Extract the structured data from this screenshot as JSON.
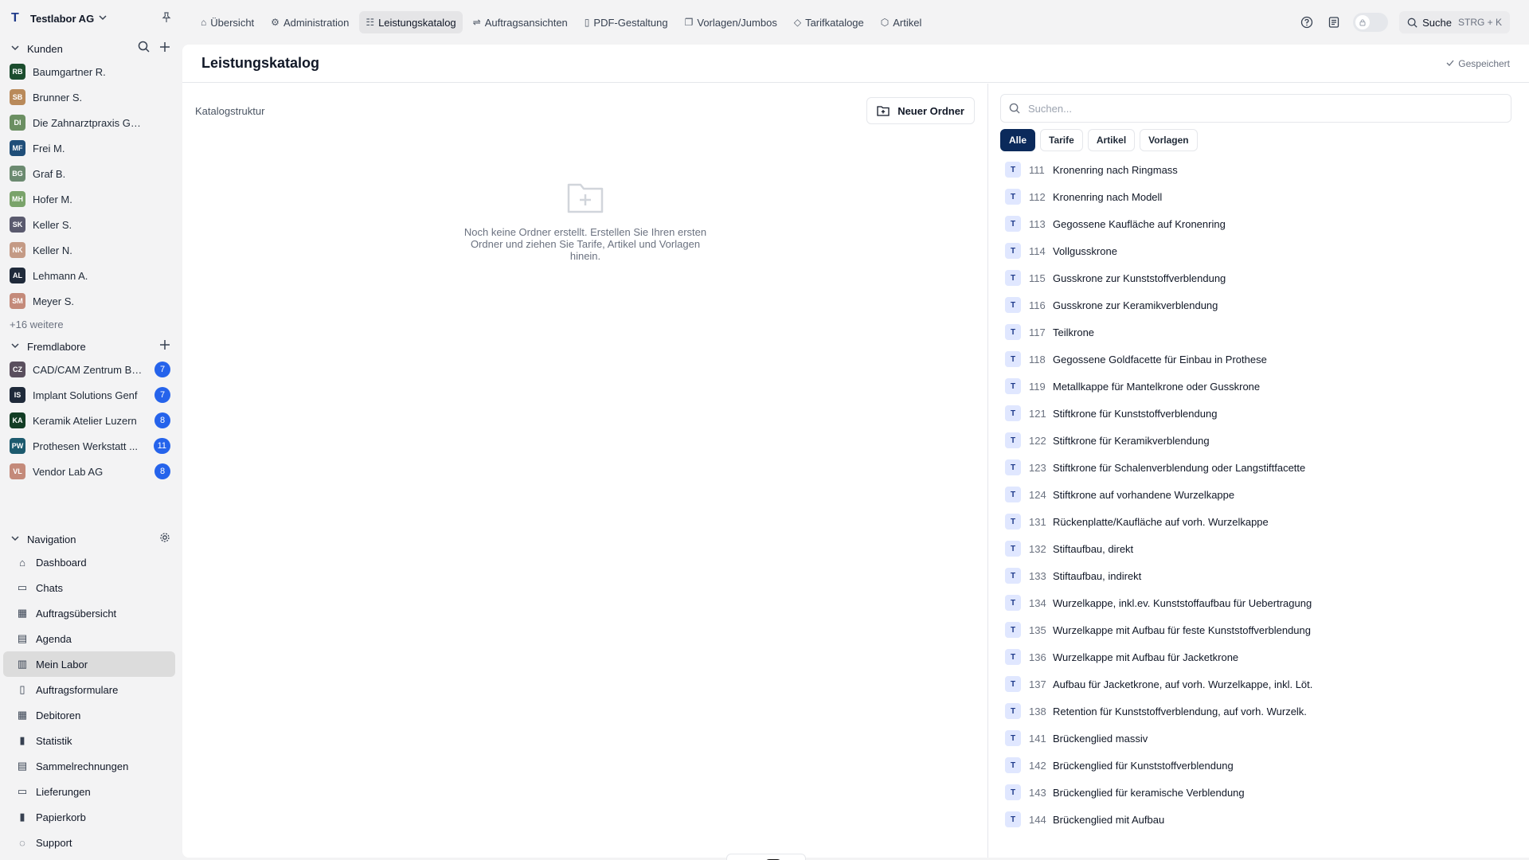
{
  "workspace": {
    "logo": "T",
    "name": "Testlabor AG"
  },
  "kunden": {
    "title": "Kunden",
    "items": [
      {
        "initials": "RB",
        "name": "Baumgartner R.",
        "color": "#1b4d2e"
      },
      {
        "initials": "SB",
        "name": "Brunner S.",
        "color": "#b98a5a"
      },
      {
        "initials": "DI",
        "name": "Die Zahnarztpraxis GmbH",
        "color": "#6b8f62"
      },
      {
        "initials": "MF",
        "name": "Frei M.",
        "color": "#1f4e79"
      },
      {
        "initials": "BG",
        "name": "Graf B.",
        "color": "#6b8a70"
      },
      {
        "initials": "MH",
        "name": "Hofer M.",
        "color": "#7aa36a"
      },
      {
        "initials": "SK",
        "name": "Keller S.",
        "color": "#5a5a6e"
      },
      {
        "initials": "NK",
        "name": "Keller N.",
        "color": "#c49a85"
      },
      {
        "initials": "AL",
        "name": "Lehmann A.",
        "color": "#1f2a3a"
      },
      {
        "initials": "SM",
        "name": "Meyer S.",
        "color": "#c48a7a"
      }
    ],
    "more": "+16 weitere"
  },
  "fremdlabore": {
    "title": "Fremdlabore",
    "items": [
      {
        "initials": "CZ",
        "name": "CAD/CAM Zentrum Ba...",
        "color": "#5a4f5e",
        "count": "7"
      },
      {
        "initials": "IS",
        "name": "Implant Solutions Genf",
        "color": "#1f2a3a",
        "count": "7"
      },
      {
        "initials": "KA",
        "name": "Keramik Atelier Luzern",
        "color": "#123d25",
        "count": "8"
      },
      {
        "initials": "PW",
        "name": "Prothesen Werkstatt ...",
        "color": "#1c5a6e",
        "count": "11"
      },
      {
        "initials": "VL",
        "name": "Vendor Lab AG",
        "color": "#c48a7a",
        "count": "8"
      }
    ]
  },
  "navigation": {
    "title": "Navigation",
    "items": [
      {
        "label": "Dashboard",
        "icon": "home-icon",
        "glyph": "⌂"
      },
      {
        "label": "Chats",
        "icon": "chat-icon",
        "glyph": "▭"
      },
      {
        "label": "Auftragsübersicht",
        "icon": "grid-icon",
        "glyph": "▦"
      },
      {
        "label": "Agenda",
        "icon": "agenda-icon",
        "glyph": "▤"
      },
      {
        "label": "Mein Labor",
        "icon": "lab-icon",
        "glyph": "▥"
      },
      {
        "label": "Auftragsformulare",
        "icon": "form-icon",
        "glyph": "▯"
      },
      {
        "label": "Debitoren",
        "icon": "table-icon",
        "glyph": "▦"
      },
      {
        "label": "Statistik",
        "icon": "bar-chart-icon",
        "glyph": "▮"
      },
      {
        "label": "Sammelrechnungen",
        "icon": "invoice-icon",
        "glyph": "▤"
      },
      {
        "label": "Lieferungen",
        "icon": "truck-icon",
        "glyph": "▭"
      },
      {
        "label": "Papierkorb",
        "icon": "trash-icon",
        "glyph": "▮"
      },
      {
        "label": "Support",
        "icon": "support-icon",
        "glyph": "◌"
      }
    ],
    "active": "Mein Labor"
  },
  "tabs": [
    {
      "label": "Übersicht",
      "icon": "home-icon",
      "glyph": "⌂"
    },
    {
      "label": "Administration",
      "icon": "gear-icon",
      "glyph": "⚙"
    },
    {
      "label": "Leistungskatalog",
      "icon": "catalog-icon",
      "glyph": "☷"
    },
    {
      "label": "Auftragsansichten",
      "icon": "sliders-icon",
      "glyph": "⇌"
    },
    {
      "label": "PDF-Gestaltung",
      "icon": "document-icon",
      "glyph": "▯"
    },
    {
      "label": "Vorlagen/Jumbos",
      "icon": "copy-icon",
      "glyph": "❐"
    },
    {
      "label": "Tarifkataloge",
      "icon": "tag-icon",
      "glyph": "◇"
    },
    {
      "label": "Artikel",
      "icon": "box-icon",
      "glyph": "⬡"
    }
  ],
  "active_tab": "Leistungskatalog",
  "topbar": {
    "search_label": "Suche",
    "search_shortcut": "STRG + K"
  },
  "page": {
    "title": "Leistungskatalog",
    "saved_label": "Gespeichert",
    "structure_title": "Katalogstruktur",
    "new_folder_label": "Neuer Ordner",
    "empty_text": "Noch keine Ordner erstellt. Erstellen Sie Ihren ersten Ordner und ziehen Sie Tarife, Artikel und Vorlagen hinein."
  },
  "catalog": {
    "search_placeholder": "Suchen...",
    "filters": [
      "Alle",
      "Tarife",
      "Artikel",
      "Vorlagen"
    ],
    "active_filter": "Alle",
    "items": [
      {
        "type": "T",
        "code": "111",
        "name": "Kronenring nach Ringmass"
      },
      {
        "type": "T",
        "code": "112",
        "name": "Kronenring nach Modell"
      },
      {
        "type": "T",
        "code": "113",
        "name": "Gegossene Kaufläche auf Kronenring"
      },
      {
        "type": "T",
        "code": "114",
        "name": "Vollgusskrone"
      },
      {
        "type": "T",
        "code": "115",
        "name": "Gusskrone zur Kunststoffverblendung"
      },
      {
        "type": "T",
        "code": "116",
        "name": "Gusskrone zur Keramikverblendung"
      },
      {
        "type": "T",
        "code": "117",
        "name": "Teilkrone"
      },
      {
        "type": "T",
        "code": "118",
        "name": "Gegossene Goldfacette für Einbau in Prothese"
      },
      {
        "type": "T",
        "code": "119",
        "name": "Metallkappe für Mantelkrone oder Gusskrone"
      },
      {
        "type": "T",
        "code": "121",
        "name": "Stiftkrone für Kunststoffverblendung"
      },
      {
        "type": "T",
        "code": "122",
        "name": "Stiftkrone für Keramikverblendung"
      },
      {
        "type": "T",
        "code": "123",
        "name": "Stiftkrone für Schalenverblendung oder Langstiftfacette"
      },
      {
        "type": "T",
        "code": "124",
        "name": "Stiftkrone auf vorhandene Wurzelkappe"
      },
      {
        "type": "T",
        "code": "131",
        "name": "Rückenplatte/Kaufläche auf vorh. Wurzelkappe"
      },
      {
        "type": "T",
        "code": "132",
        "name": "Stiftaufbau, direkt"
      },
      {
        "type": "T",
        "code": "133",
        "name": "Stiftaufbau, indirekt"
      },
      {
        "type": "T",
        "code": "134",
        "name": "Wurzelkappe, inkl.ev. Kunststoffaufbau für Uebertragung"
      },
      {
        "type": "T",
        "code": "135",
        "name": "Wurzelkappe mit Aufbau für feste Kunststoffverblendung"
      },
      {
        "type": "T",
        "code": "136",
        "name": "Wurzelkappe mit Aufbau für Jacketkrone"
      },
      {
        "type": "T",
        "code": "137",
        "name": "Aufbau für Jacketkrone, auf vorh. Wurzelkappe, inkl. Löt."
      },
      {
        "type": "T",
        "code": "138",
        "name": "Retention für Kunststoffverblendung, auf vorh. Wurzelk."
      },
      {
        "type": "T",
        "code": "141",
        "name": "Brückenglied massiv"
      },
      {
        "type": "T",
        "code": "142",
        "name": "Brückenglied für Kunststoffverblendung"
      },
      {
        "type": "T",
        "code": "143",
        "name": "Brückenglied für keramische Verblendung"
      },
      {
        "type": "T",
        "code": "144",
        "name": "Brückenglied mit Aufbau"
      }
    ]
  },
  "colors": {
    "accent": "#0b2a5b",
    "badge": "#2563eb",
    "active_nav": "#dcdcdc"
  }
}
